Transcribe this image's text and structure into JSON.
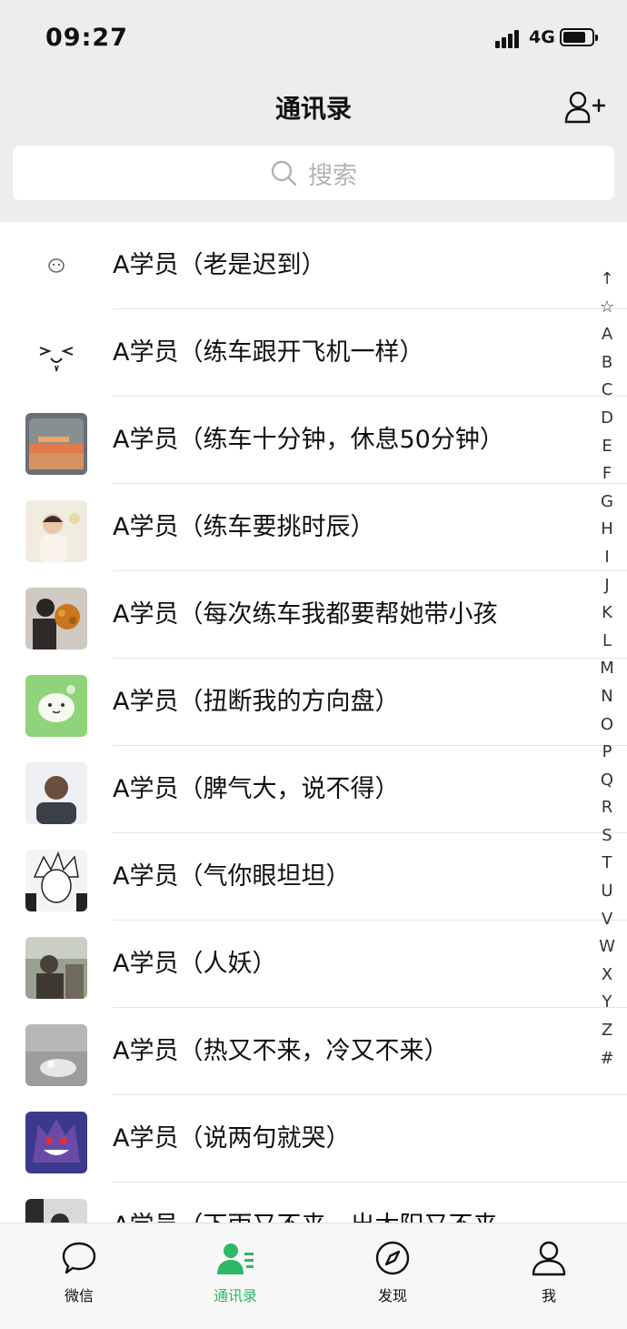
{
  "status_bar": {
    "time": "09:27",
    "network": "4G"
  },
  "nav": {
    "title": "通讯录"
  },
  "search": {
    "placeholder": "搜索"
  },
  "contacts": [
    {
      "name": "A学员（老是迟到）"
    },
    {
      "name": "A学员（练车跟开飞机一样）"
    },
    {
      "name": "A学员（练车十分钟，休息50分钟）"
    },
    {
      "name": "A学员（练车要挑时辰）"
    },
    {
      "name": "A学员（每次练车我都要帮她带小孩"
    },
    {
      "name": "A学员（扭断我的方向盘）"
    },
    {
      "name": "A学员（脾气大，说不得）"
    },
    {
      "name": "A学员（气你眼坦坦）"
    },
    {
      "name": "A学员（人妖）"
    },
    {
      "name": "A学员（热又不来，冷又不来）"
    },
    {
      "name": "A学员（说两句就哭）"
    },
    {
      "name": "A学员（下雨又不来，出太阳又不来"
    }
  ],
  "index_bar": [
    "↑",
    "☆",
    "A",
    "B",
    "C",
    "D",
    "E",
    "F",
    "G",
    "H",
    "I",
    "J",
    "K",
    "L",
    "M",
    "N",
    "O",
    "P",
    "Q",
    "R",
    "S",
    "T",
    "U",
    "V",
    "W",
    "X",
    "Y",
    "Z",
    "#"
  ],
  "tabs": [
    {
      "label": "微信",
      "icon": "chat-bubble-icon",
      "active": false
    },
    {
      "label": "通讯录",
      "icon": "contacts-icon",
      "active": true
    },
    {
      "label": "发现",
      "icon": "compass-icon",
      "active": false
    },
    {
      "label": "我",
      "icon": "person-icon",
      "active": false
    }
  ],
  "colors": {
    "accent": "#2fb666",
    "background": "#ededed"
  }
}
